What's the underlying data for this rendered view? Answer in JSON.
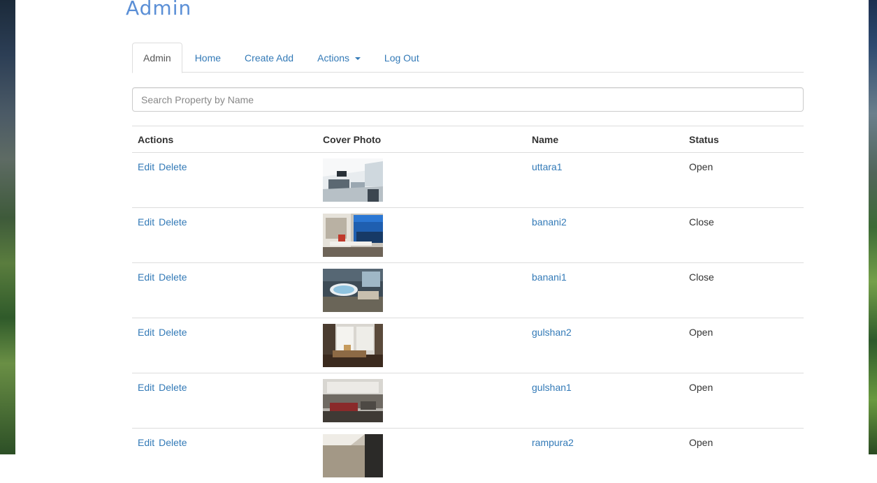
{
  "page": {
    "title": "Admin"
  },
  "nav": {
    "tabs": [
      {
        "label": "Admin",
        "active": true
      },
      {
        "label": "Home"
      },
      {
        "label": "Create Add"
      },
      {
        "label": "Actions",
        "dropdown": true
      },
      {
        "label": "Log Out"
      }
    ]
  },
  "search": {
    "placeholder": "Search Property by Name",
    "value": ""
  },
  "table": {
    "headers": {
      "actions": "Actions",
      "cover_photo": "Cover Photo",
      "name": "Name",
      "status": "Status"
    },
    "rows": [
      {
        "edit": "Edit",
        "delete": "Delete",
        "name": "uttara1",
        "status": "Open",
        "photo": "bright-white-living-room"
      },
      {
        "edit": "Edit",
        "delete": "Delete",
        "name": "banani2",
        "status": "Close",
        "photo": "office-with-blue-window"
      },
      {
        "edit": "Edit",
        "delete": "Delete",
        "name": "banani1",
        "status": "Close",
        "photo": "bathroom-with-round-tub"
      },
      {
        "edit": "Edit",
        "delete": "Delete",
        "name": "gulshan2",
        "status": "Open",
        "photo": "loft-living-room"
      },
      {
        "edit": "Edit",
        "delete": "Delete",
        "name": "gulshan1",
        "status": "Open",
        "photo": "lounge-with-red-sofa"
      },
      {
        "edit": "Edit",
        "delete": "Delete",
        "name": "rampura2",
        "status": "Open",
        "photo": "dark-kitchen-interior"
      }
    ]
  },
  "colors": {
    "link": "#337ab7",
    "title": "#5b8fd6",
    "border": "#dddddd"
  }
}
